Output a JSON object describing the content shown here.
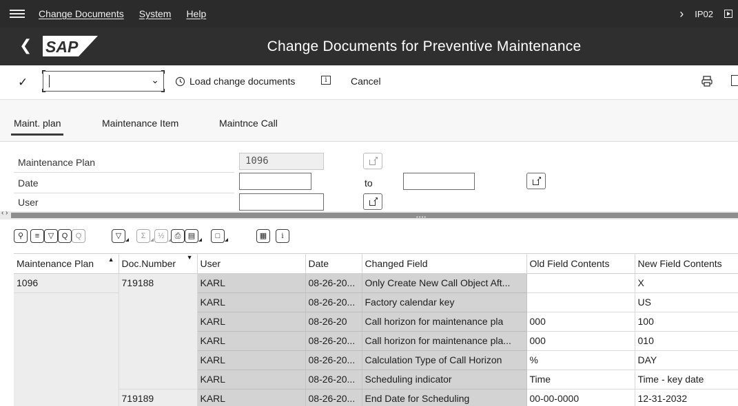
{
  "menubar": {
    "items": [
      "Change Documents",
      "System",
      "Help"
    ],
    "system_id": "IP02"
  },
  "titlebar": {
    "logo_text": "SAP",
    "title": "Change Documents for Preventive Maintenance"
  },
  "toolbar": {
    "command_value": "",
    "load_label": "Load change documents",
    "cancel_label": "Cancel"
  },
  "tabs": [
    {
      "label": "Maint. plan",
      "active": true
    },
    {
      "label": "Maintenance Item",
      "active": false
    },
    {
      "label": "Maintnce Call",
      "active": false
    }
  ],
  "form": {
    "plan_label": "Maintenance Plan",
    "plan_value": "1096",
    "date_label": "Date",
    "date_from": "",
    "to_label": "to",
    "date_to": "",
    "user_label": "User",
    "user_value": ""
  },
  "alv_icons": [
    "zoom-icon",
    "align-center-icon",
    "filter-lines-icon",
    "find-icon",
    "find-next-icon",
    "filter-icon",
    "sum-icon",
    "subtotal-icon",
    "print-icon",
    "export-icon",
    "layout-icon",
    "grid-icon",
    "info-icon"
  ],
  "grid": {
    "columns": [
      "Maintenance Plan",
      "Doc.Number",
      "User",
      "Date",
      "Changed Field",
      "Old Field Contents",
      "New Field Contents"
    ],
    "rows": [
      [
        "1096",
        "719188",
        "KARL",
        "08-26-20...",
        "Only Create New Call Object Aft...",
        "",
        "X"
      ],
      [
        "",
        "",
        "KARL",
        "08-26-20...",
        "Factory calendar key",
        "",
        "US"
      ],
      [
        "",
        "",
        "KARL",
        "08-26-20",
        "Call horizon for maintenance pla",
        "000",
        "100"
      ],
      [
        "",
        "",
        "KARL",
        "08-26-20...",
        "Call horizon for maintenance pla...",
        "000",
        "010"
      ],
      [
        "",
        "",
        "KARL",
        "08-26-20...",
        "Calculation Type of Call Horizon",
        "%",
        "DAY"
      ],
      [
        "",
        "",
        "KARL",
        "08-26-20...",
        "Scheduling indicator",
        "Time",
        "Time - key date"
      ],
      [
        "",
        "719189",
        "KARL",
        "08-26-20...",
        "End Date for Scheduling",
        "00-00-0000",
        "12-31-2032"
      ]
    ]
  }
}
